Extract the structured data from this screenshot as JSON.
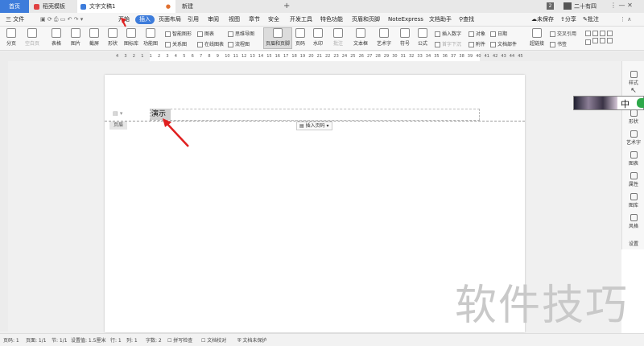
{
  "title_bar": {
    "home_tab": "首页",
    "template_tab": "稻壳模板",
    "doc_tab": "文字文稿1",
    "new_tab": "新建",
    "tab_count": "2",
    "user_name": "二十有四"
  },
  "menu": {
    "file": "三 文件",
    "items": [
      "开始",
      "插入",
      "页面布局",
      "引用",
      "审阅",
      "视图",
      "章节",
      "安全",
      "开发工具",
      "特色功能",
      "页眉和页脚",
      "NoteExpress",
      "文档助手"
    ],
    "search": "查找",
    "unsaved": "未保存",
    "share": "分享",
    "comment": "批注"
  },
  "ribbon": {
    "big": [
      "分页",
      "空白页"
    ],
    "table": "表格",
    "picture": "图片",
    "screenshot": "截屏",
    "shape": "形状",
    "icon_lib": "图标库",
    "func_chart": "功能图",
    "smart_shape": "智能图形",
    "chart": "图表",
    "mind_map": "思维导图",
    "relation": "关系图",
    "online_chart": "在线图表",
    "flow_chart": "流程图",
    "header_footer": "页眉和页脚",
    "page_num": "页码",
    "watermark": "水印",
    "annotation": "批注",
    "textbox": "文本框",
    "art_text": "艺术字",
    "symbol": "符号",
    "formula": "公式",
    "insert_num": "插入数字",
    "first_sink": "首字下沉",
    "object": "对象",
    "date": "日期",
    "attachment": "附件",
    "doc_part": "文档部件",
    "hyperlink": "超链接",
    "cross_ref": "交叉引用",
    "bookmark": "书签"
  },
  "ruler_ticks": [
    "4",
    "3",
    "2",
    "1",
    "1",
    "2",
    "3",
    "4",
    "5",
    "6",
    "7",
    "8",
    "9",
    "10",
    "11",
    "12",
    "13",
    "14",
    "15",
    "16",
    "17",
    "18",
    "19",
    "20",
    "21",
    "22",
    "23",
    "24",
    "25",
    "26",
    "27",
    "28",
    "29",
    "30",
    "31",
    "32",
    "33",
    "34",
    "35",
    "36",
    "37",
    "38",
    "39",
    "40",
    "41",
    "42",
    "43",
    "44",
    "45"
  ],
  "document": {
    "header_text": "演示",
    "header_label": "页眉",
    "insert_page_num": "插入页码"
  },
  "ime": {
    "text": "中"
  },
  "right_panel": [
    "样式",
    "选择",
    "形状",
    "艺术字",
    "图表",
    "属性",
    "图库",
    "风格",
    "设置"
  ],
  "status": {
    "page": "页码: 1",
    "pages": "页面: 1/1",
    "section": "节: 1/1",
    "setting": "设置值: 1.5厘米",
    "row": "行: 1",
    "col": "列: 1",
    "words": "字数: 2",
    "spell": "拼写检查",
    "proof": "文档校对",
    "protect": "文档未保护"
  },
  "watermark": "软件技巧",
  "colors": {
    "accent": "#3d7cdb",
    "arrow": "#e02020"
  }
}
